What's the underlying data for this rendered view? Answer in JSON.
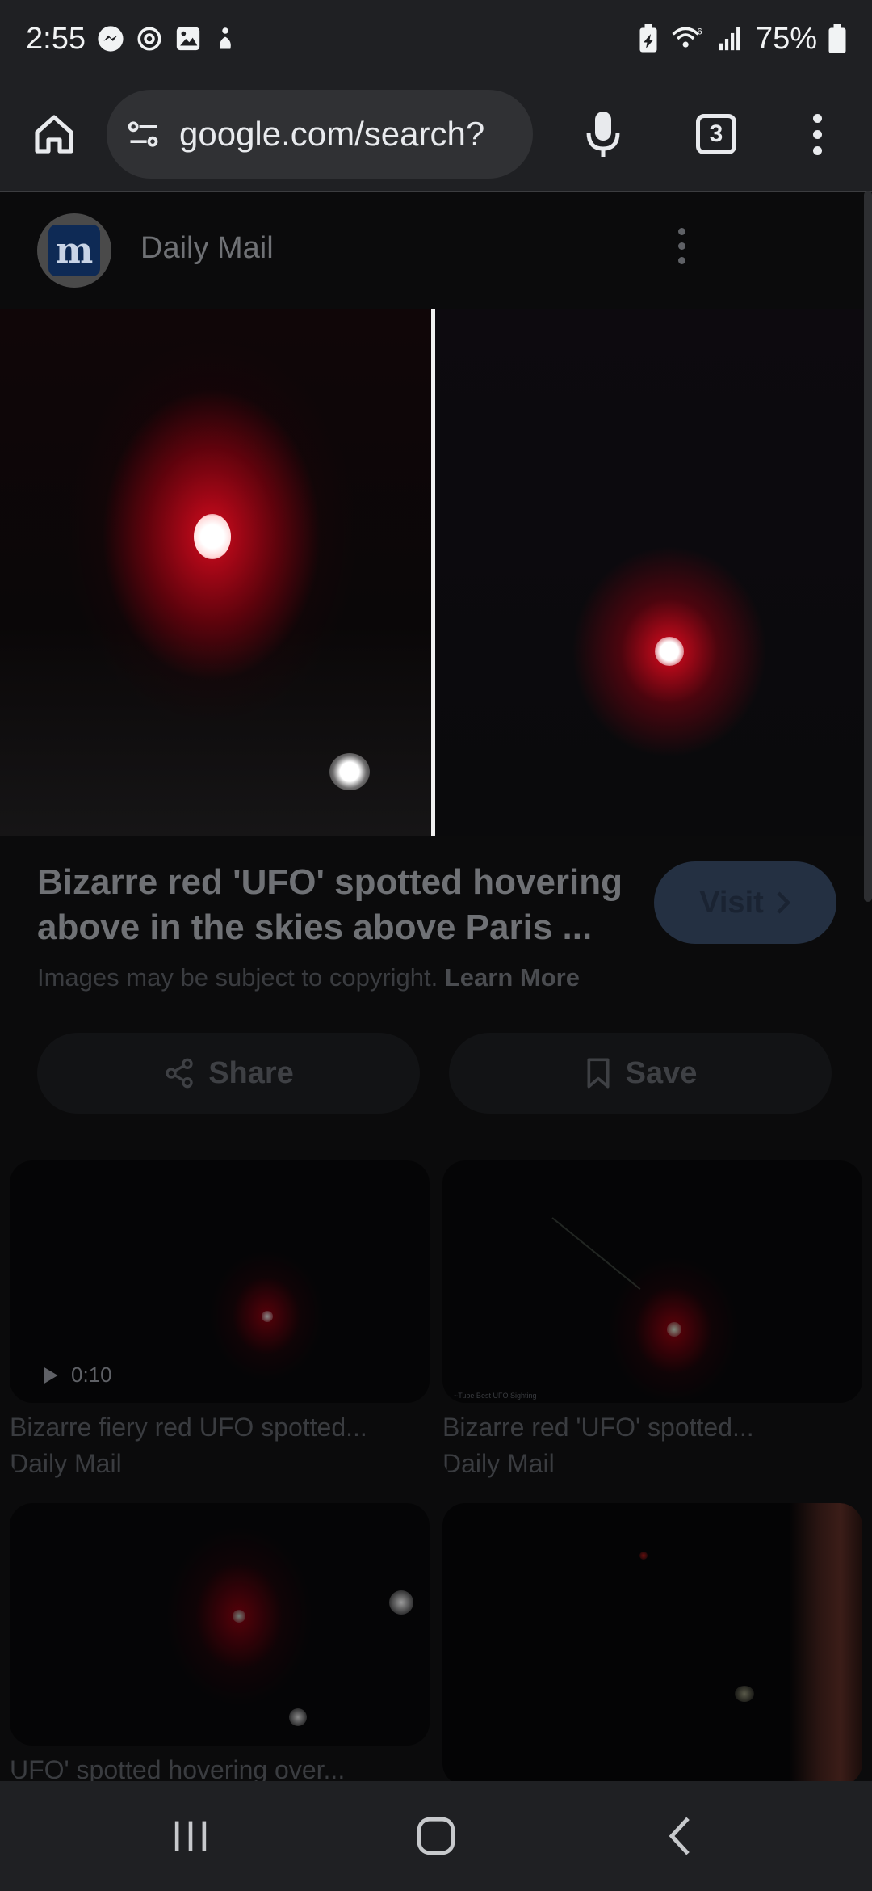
{
  "status_bar": {
    "time": "2:55",
    "battery": "75%",
    "left_icons": [
      "messenger-icon",
      "sync-icon",
      "gallery-icon",
      "accessibility-icon"
    ],
    "right_icons": [
      "battery-saver-icon",
      "wifi-6-icon",
      "signal-icon",
      "battery-icon"
    ]
  },
  "browser": {
    "url": "google.com/search?",
    "tab_count": "3"
  },
  "result": {
    "source_name": "Daily Mail",
    "source_logo_letter": "m",
    "title": "Bizarre red 'UFO' spotted hovering above in the skies above Paris ...",
    "visit_label": "Visit",
    "copyright_text": "Images may be subject to copyright.",
    "learn_more": "Learn More",
    "share_label": "Share",
    "save_label": "Save"
  },
  "related": [
    {
      "title": "Bizarre fiery red UFO spotted...",
      "source": "Daily Mail",
      "duration": "0:10"
    },
    {
      "title": "Bizarre red 'UFO' spotted...",
      "source": "Daily Mail",
      "watermark": "~Tube Best UFO Sighting"
    },
    {
      "title": "UFO' spotted hovering over...",
      "source": ""
    },
    {
      "title": "",
      "source": ""
    }
  ],
  "colors": {
    "background": "#0b0b0c",
    "bar": "#1f2023",
    "url_pill": "#303134",
    "glow_red": "#dc0a1e"
  }
}
